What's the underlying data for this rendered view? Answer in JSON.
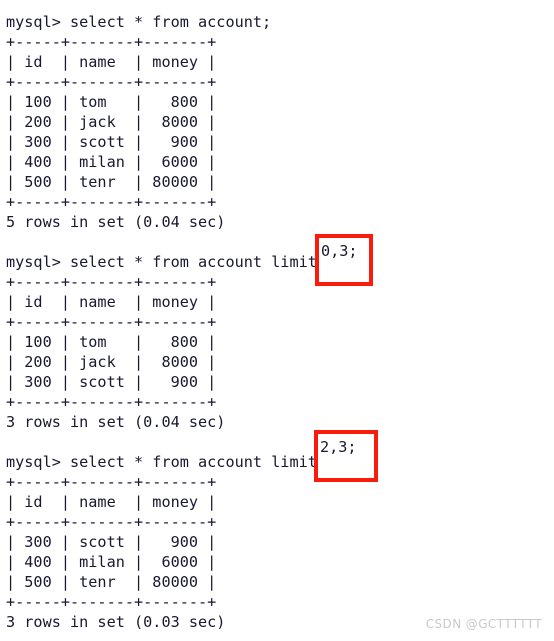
{
  "terminal": {
    "prompt": "mysql> ",
    "divider": "+-----+-------+-------+",
    "header_row": "| id  | name  | money |",
    "blocks": [
      {
        "id": "block-1",
        "command": "mysql> select * from account;",
        "divider_top": "+-----+-------+-------+",
        "header": "| id  | name  | money |",
        "divider_mid": "+-----+-------+-------+",
        "rows": [
          "| 100 | tom   |   800 |",
          "| 200 | jack  |  8000 |",
          "| 300 | scott |   900 |",
          "| 400 | milan |  6000 |",
          "| 500 | tenr  | 80000 |"
        ],
        "divider_bottom": "+-----+-------+-------+",
        "status": "5 rows in set (0.04 sec)"
      },
      {
        "id": "block-2",
        "command": "mysql> select * from account limit 0,3;",
        "command_prefix": "mysql> select * from account limit ",
        "command_highlight": "0,3;",
        "divider_top": "+-----+-------+-------+",
        "header": "| id  | name  | money |",
        "divider_mid": "+-----+-------+-------+",
        "rows": [
          "| 100 | tom   |   800 |",
          "| 200 | jack  |  8000 |",
          "| 300 | scott |   900 |"
        ],
        "divider_bottom": "+-----+-------+-------+",
        "status": "3 rows in set (0.04 sec)"
      },
      {
        "id": "block-3",
        "command": "mysql> select * from account limit 2,3;",
        "command_prefix": "mysql> select * from account limit ",
        "command_highlight": "2,3;",
        "divider_top": "+-----+-------+-------+",
        "header": "| id  | name  | money |",
        "divider_mid": "+-----+-------+-------+",
        "rows": [
          "| 300 | scott |   900 |",
          "| 400 | milan |  6000 |",
          "| 500 | tenr  | 80000 |"
        ],
        "divider_bottom": "+-----+-------+-------+",
        "status": "3 rows in set (0.03 sec)"
      }
    ],
    "table_data": {
      "columns": [
        "id",
        "name",
        "money"
      ],
      "all_rows": [
        {
          "id": "100",
          "name": "tom",
          "money": "800"
        },
        {
          "id": "200",
          "name": "jack",
          "money": "8000"
        },
        {
          "id": "300",
          "name": "scott",
          "money": "900"
        },
        {
          "id": "400",
          "name": "milan",
          "money": "6000"
        },
        {
          "id": "500",
          "name": "tenr",
          "money": "80000"
        }
      ]
    }
  },
  "annotations": {
    "color": "#f91c0c",
    "box_1_text": "0,3;",
    "box_2_text": "2,3;"
  },
  "watermark": {
    "text": "CSDN @GCTTTTTT",
    "color": "#c9c9c9"
  }
}
